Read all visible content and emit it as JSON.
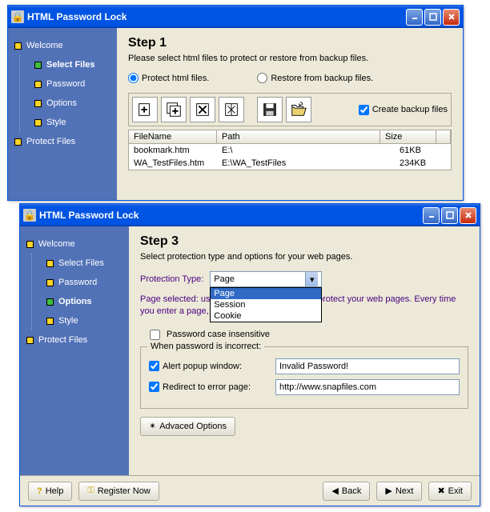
{
  "app_title": "HTML Password Lock",
  "sidebar": {
    "items": [
      {
        "label": "Welcome",
        "bullet": "yellow",
        "sub": false
      },
      {
        "label": "Select Files",
        "bullet": "green",
        "sub": true
      },
      {
        "label": "Password",
        "bullet": "yellow",
        "sub": true
      },
      {
        "label": "Options",
        "bullet": "yellow",
        "sub": true
      },
      {
        "label": "Style",
        "bullet": "yellow",
        "sub": true
      },
      {
        "label": "Protect Files",
        "bullet": "yellow",
        "sub": false
      }
    ]
  },
  "step1": {
    "title": "Step 1",
    "desc": "Please select html files to protect or restore from backup files.",
    "radio_protect": "Protect html files.",
    "radio_restore": "Restore from backup files.",
    "create_backup_label": "Create backup files",
    "columns": {
      "name": "FileName",
      "path": "Path",
      "size": "Size"
    },
    "rows": [
      {
        "name": "bookmark.htm",
        "path": "E:\\",
        "size": "61KB"
      },
      {
        "name": "WA_TestFiles.htm",
        "path": "E:\\WA_TestFiles",
        "size": "234KB"
      }
    ]
  },
  "step3": {
    "title": "Step 3",
    "desc": "Select protection type and options for your web pages.",
    "protection_type_label": "Protection Type:",
    "protection_type_value": "Page",
    "protection_type_options": [
      "Page",
      "Session",
      "Cookie"
    ],
    "hint": "Page selected: use the simplest protection to protect your web pages. Every time you enter a page, a password is needed.",
    "case_insensitive_label": "Password case insensitive",
    "incorrect_legend": "When password is incorrect:",
    "alert_label": "Alert popup window:",
    "alert_value": "Invalid Password!",
    "redirect_label": "Redirect to error page:",
    "redirect_value": "http://www.snapfiles.com",
    "advanced_label": "Advaced Options"
  },
  "buttons": {
    "help": "Help",
    "register": "Register Now",
    "back": "Back",
    "next": "Next",
    "exit": "Exit"
  }
}
